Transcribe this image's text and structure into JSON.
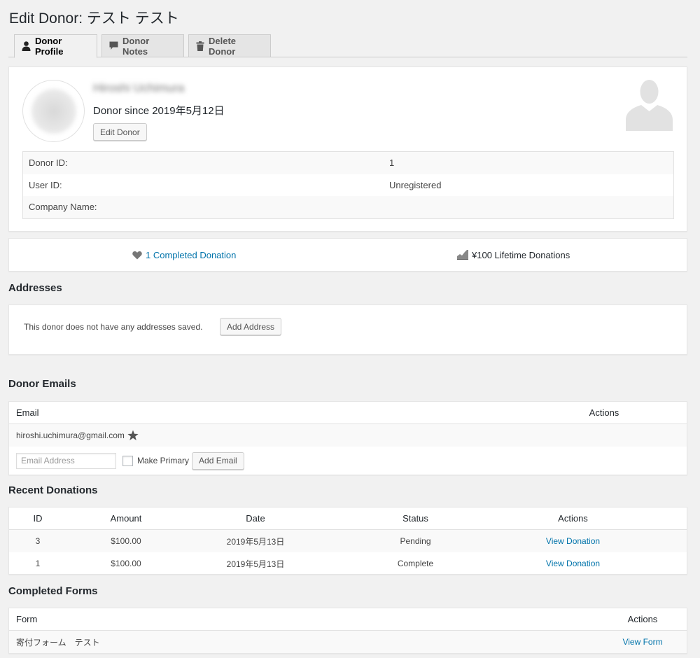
{
  "page": {
    "title": "Edit Donor: テスト テスト"
  },
  "tabs": [
    {
      "label": "Donor Profile",
      "icon": "person-icon",
      "active": true
    },
    {
      "label": "Donor Notes",
      "icon": "speech-bubble-icon",
      "active": false
    },
    {
      "label": "Delete Donor",
      "icon": "trash-icon",
      "active": false
    }
  ],
  "profile": {
    "name": "Hiroshi Uchimura",
    "since": "Donor since 2019年5月12日",
    "edit_label": "Edit Donor",
    "rows": [
      {
        "key": "Donor ID:",
        "value": "1"
      },
      {
        "key": "User ID:",
        "value": "Unregistered"
      },
      {
        "key": "Company Name:",
        "value": ""
      }
    ]
  },
  "stats": {
    "completed": "1 Completed Donation",
    "lifetime": "¥100 Lifetime Donations"
  },
  "addresses": {
    "title": "Addresses",
    "empty_text": "This donor does not have any addresses saved.",
    "add_label": "Add Address"
  },
  "emails": {
    "title": "Donor Emails",
    "col_email": "Email",
    "col_actions": "Actions",
    "primary_email": "hiroshi.uchimura@gmail.com",
    "input_placeholder": "Email Address",
    "make_primary_label": "Make Primary",
    "add_label": "Add Email"
  },
  "donations": {
    "title": "Recent Donations",
    "headers": [
      "ID",
      "Amount",
      "Date",
      "Status",
      "Actions"
    ],
    "rows": [
      {
        "id": "3",
        "amount": "$100.00",
        "date": "2019年5月13日",
        "status": "Pending",
        "action": "View Donation"
      },
      {
        "id": "1",
        "amount": "$100.00",
        "date": "2019年5月13日",
        "status": "Complete",
        "action": "View Donation"
      }
    ]
  },
  "forms": {
    "title": "Completed Forms",
    "col_form": "Form",
    "col_actions": "Actions",
    "rows": [
      {
        "form": "寄付フォーム　テスト",
        "action": "View Form"
      }
    ]
  },
  "colors": {
    "link": "#0073aa",
    "text": "#23282d",
    "background": "#f1f1f1"
  }
}
